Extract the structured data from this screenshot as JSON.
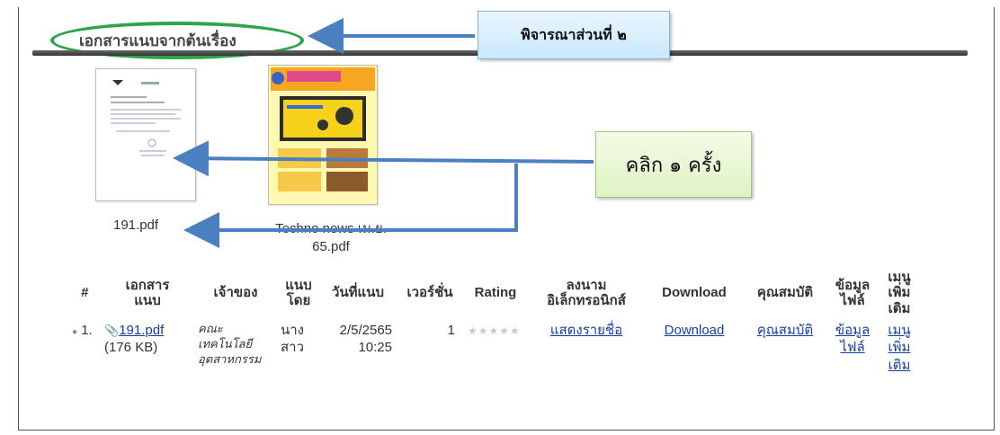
{
  "section": {
    "title": "เอกสารแนบจากต้นเรื่อง"
  },
  "callouts": {
    "part2": "พิจารณาส่วนที่ ๒",
    "click_once": "คลิก ๑ ครั้ง"
  },
  "thumbnails": [
    {
      "label": "191.pdf"
    },
    {
      "label_line1": "Techno news เม.ย.",
      "label_line2": "65.pdf"
    }
  ],
  "table": {
    "headers": {
      "num": "#",
      "attachment": [
        "เอกสาร",
        "แนบ"
      ],
      "owner": "เจ้าของ",
      "attached_by": [
        "แนบ",
        "โดย"
      ],
      "date": "วันที่แนบ",
      "version": "เวอร์ชั่น",
      "rating": "Rating",
      "signature": [
        "ลงนาม",
        "อิเล็กทรอนิกส์"
      ],
      "download": "Download",
      "properties": "คุณสมบัติ",
      "file_info": [
        "ข้อมูล",
        "ไฟล์"
      ],
      "more_menu": [
        "เมนู",
        "เพิ่ม",
        "เติม"
      ]
    },
    "row": {
      "index": "1.",
      "file_name": "191.pdf",
      "file_size": "(176 KB)",
      "owner_lines": [
        "คณะ",
        "เทคโนโลยี",
        "อุตสาหกรรม"
      ],
      "attached_by_lines": [
        "นาง",
        "สาว"
      ],
      "date": "2/5/2565",
      "time": "10:25",
      "version": "1",
      "rating_stars": "★★★★★",
      "signature_link": "แสดงรายชื่อ",
      "download_link": "Download",
      "properties_link": "คุณสมบัติ",
      "file_info_lines": [
        "ข้อมูล",
        "ไฟล์"
      ],
      "more_menu_lines": [
        "เมนู",
        "เพิ่ม",
        "เติม"
      ]
    }
  },
  "colors": {
    "oval": "#2fa34a",
    "arrow": "#4a7fc0",
    "callout_blue": "#c9e7fb",
    "callout_green": "#dff3c4",
    "link": "#1a3e9a"
  }
}
